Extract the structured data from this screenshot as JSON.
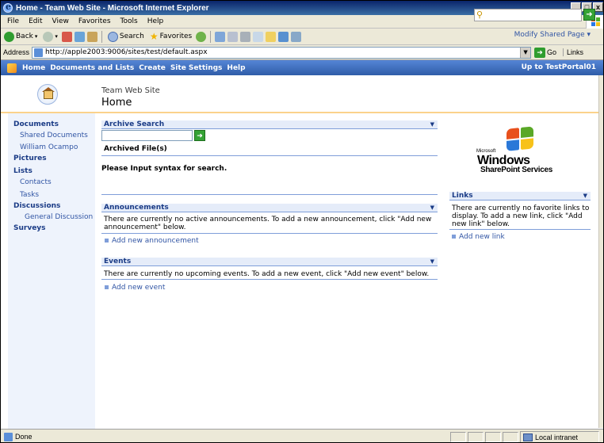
{
  "window": {
    "title": "Home - Team Web Site - Microsoft Internet Explorer",
    "controls": [
      "_",
      "□",
      "x"
    ]
  },
  "menubar": [
    "File",
    "Edit",
    "View",
    "Favorites",
    "Tools",
    "Help"
  ],
  "toolbar": {
    "back": "Back",
    "search": "Search",
    "favorites": "Favorites"
  },
  "address": {
    "label": "Address",
    "url": "http://apple2003:9006/sites/test/default.aspx",
    "go": "Go",
    "links": "Links"
  },
  "spnav": {
    "items": [
      "Home",
      "Documents and Lists",
      "Create",
      "Site Settings",
      "Help"
    ],
    "up_to": "Up to TestPortal01"
  },
  "header": {
    "site_title": "Team Web Site",
    "page_title": "Home",
    "modify_link": "Modify Shared Page ▾"
  },
  "quicklaunch": {
    "documents": "Documents",
    "shared_documents": "Shared Documents",
    "william": "William Ocampo",
    "pictures": "Pictures",
    "lists": "Lists",
    "contacts": "Contacts",
    "tasks": "Tasks",
    "discussions": "Discussions",
    "general_discussion": "General Discussion",
    "surveys": "Surveys"
  },
  "archive": {
    "title": "Archive Search",
    "archived_files": "Archived File(s)",
    "prompt": "Please Input syntax for search."
  },
  "announcements": {
    "title": "Announcements",
    "body": "There are currently no active announcements. To add a new announcement, click \"Add new announcement\" below.",
    "add": "Add new announcement"
  },
  "events": {
    "title": "Events",
    "body": "There are currently no upcoming events. To add a new event, click \"Add new event\" below.",
    "add": "Add new event"
  },
  "links": {
    "title": "Links",
    "body": "There are currently no favorite links to display. To add a new link, click \"Add new link\" below.",
    "add": "Add new link"
  },
  "logo": {
    "microsoft": "Microsoft",
    "windows": "Windows",
    "sharepoint": "SharePoint Services"
  },
  "statusbar": {
    "status": "Done",
    "zone": "Local intranet"
  },
  "colors": {
    "nav_blue": "#2f5da8",
    "link_blue": "#3155a4",
    "heading_blue": "#1a3b86",
    "header_rule": "#fbd28b",
    "quicklaunch_bg": "#eef3fc"
  }
}
